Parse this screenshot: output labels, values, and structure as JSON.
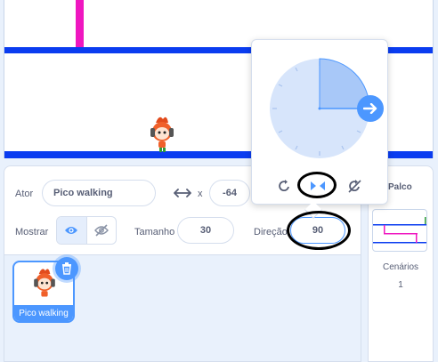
{
  "sprite_info": {
    "sprite_label": "Ator",
    "sprite_name": "Pico walking",
    "x_label": "x",
    "x_value": "-64",
    "show_label": "Mostrar",
    "size_label": "Tamanho",
    "size_value": "30",
    "direction_label": "Direção",
    "direction_value": "90"
  },
  "sprite_list": {
    "items": [
      {
        "label": "Pico walking",
        "selected": true
      }
    ]
  },
  "stage_panel": {
    "title": "Palco",
    "backdrops_label": "Cenários",
    "backdrops_count": "1"
  },
  "direction_popover": {
    "value_degrees": 90,
    "modes": [
      "all-around-icon",
      "left-right-icon",
      "dont-rotate-icon"
    ],
    "selected_mode": "left-right-icon"
  },
  "colors": {
    "accent": "#4c97ff",
    "stage_line": "#0a3cf0",
    "stage_bar": "#ef17c0"
  }
}
